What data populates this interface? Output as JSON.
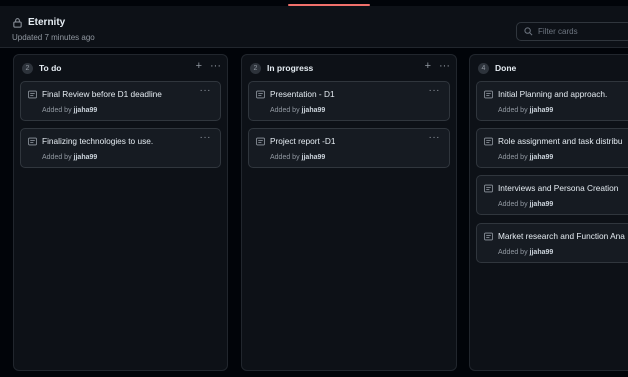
{
  "project": {
    "title": "Eternity",
    "updated": "Updated 7 minutes ago"
  },
  "filter": {
    "placeholder": "Filter cards"
  },
  "column_actions": {
    "add": "+",
    "more": "···"
  },
  "columns": [
    {
      "name": "To do",
      "count": "2",
      "cards": [
        {
          "title": "Final Review before D1 deadline",
          "added_prefix": "Added by",
          "user": "jjaha99"
        },
        {
          "title": "Finalizing technologies to use.",
          "added_prefix": "Added by",
          "user": "jjaha99"
        }
      ]
    },
    {
      "name": "In progress",
      "count": "2",
      "cards": [
        {
          "title": "Presentation - D1",
          "added_prefix": "Added by",
          "user": "jjaha99"
        },
        {
          "title": "Project report -D1",
          "added_prefix": "Added by",
          "user": "jjaha99"
        }
      ]
    },
    {
      "name": "Done",
      "count": "4",
      "cards": [
        {
          "title": "Initial Planning and approach.",
          "added_prefix": "Added by",
          "user": "jjaha99"
        },
        {
          "title": "Role assignment and task distribu",
          "added_prefix": "Added by",
          "user": "jjaha99"
        },
        {
          "title": "Interviews and Persona Creation",
          "added_prefix": "Added by",
          "user": "jjaha99"
        },
        {
          "title": "Market research and Function Ana",
          "added_prefix": "Added by",
          "user": "jjaha99"
        }
      ]
    }
  ],
  "colors": {
    "background": "#010409",
    "column_bg": "#0d1117",
    "card_bg": "#161b22",
    "border": "#30363d",
    "accent": "#f0706b",
    "muted_text": "#9198a1"
  }
}
